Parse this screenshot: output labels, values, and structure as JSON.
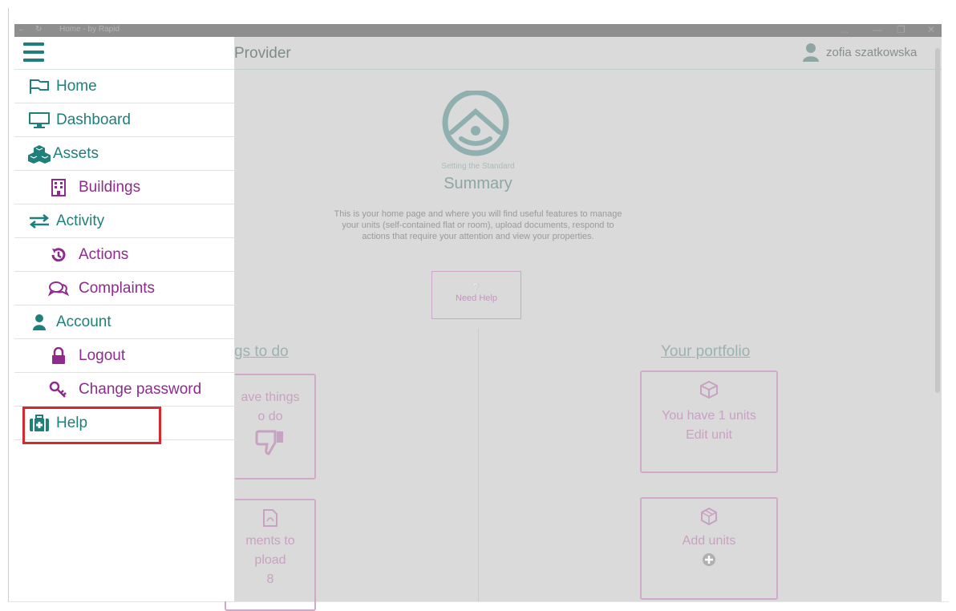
{
  "window": {
    "title": "Home - by Rapid",
    "controls": [
      "...",
      "—",
      "❐",
      "✕"
    ]
  },
  "header": {
    "title": "Provider",
    "user_name": "zofia szatkowska"
  },
  "hero": {
    "tagline": "Setting the Standard",
    "title": "Summary",
    "intro": "This is your home page and where you will find useful features to manage your units (self-contained flat or room), upload documents, respond to actions that require your attention and view your properties.",
    "help_label": "Need Help"
  },
  "left_section": {
    "title": "gs to do",
    "card1_line1": "ave things",
    "card1_line2": "o do",
    "card2_line1": "ments to",
    "card2_line2": "pload",
    "card2_count": "8"
  },
  "right_section": {
    "title": "Your portfolio",
    "units_text": "You have 1 units",
    "edit_text": "Edit unit",
    "add_text": "Add units"
  },
  "menu": {
    "home": "Home",
    "dashboard": "Dashboard",
    "assets": "Assets",
    "buildings": "Buildings",
    "activity": "Activity",
    "actions": "Actions",
    "complaints": "Complaints",
    "account": "Account",
    "logout": "Logout",
    "change_password": "Change password",
    "help": "Help"
  },
  "colors": {
    "teal": "#1f7f7b",
    "purple": "#8e2b8c",
    "highlight": "#d7282e",
    "overlay": "#dadada"
  }
}
